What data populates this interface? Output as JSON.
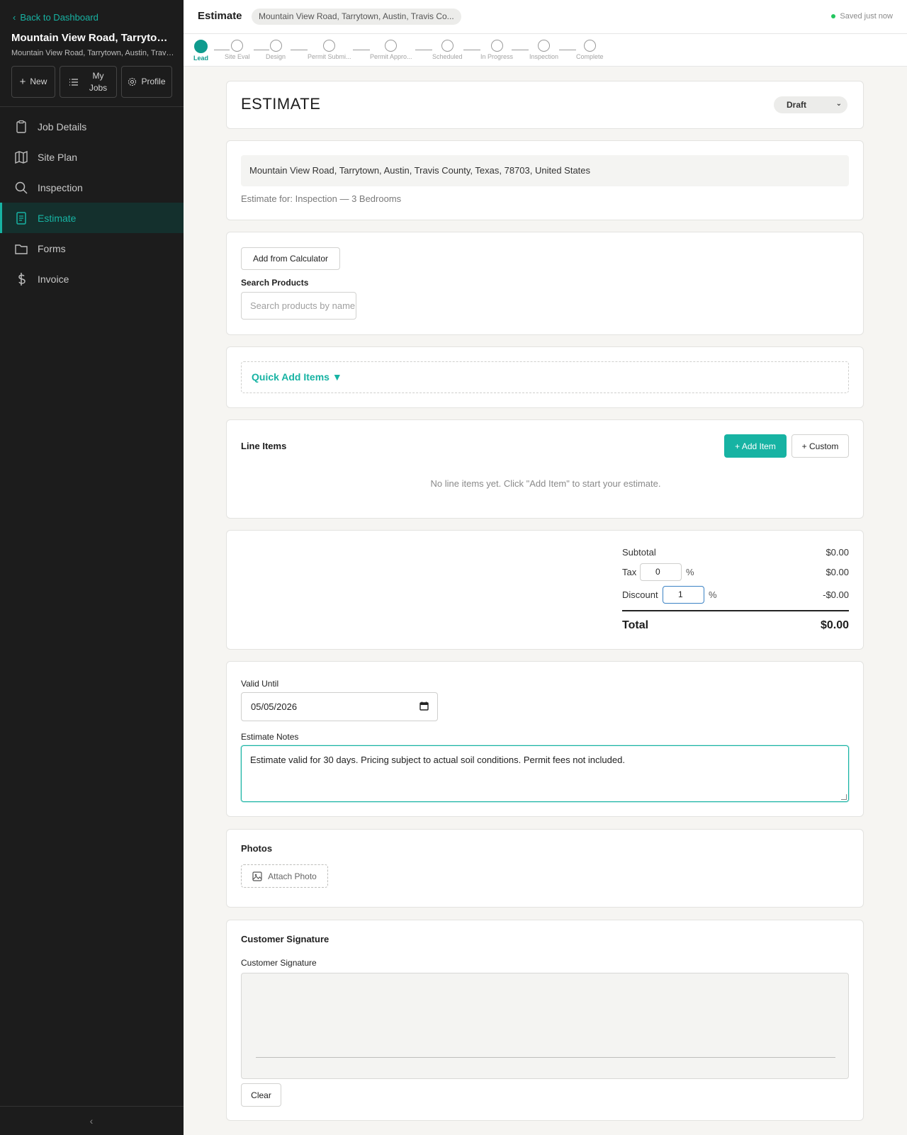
{
  "sidebar": {
    "back_label": "Back to Dashboard",
    "job_title": "Mountain View Road, Tarrytown, Austin, Travis County, Texas",
    "job_subtitle": "Mountain View Road, Tarrytown, Austin, Travis County, Texas",
    "buttons": {
      "new": "New",
      "my_jobs_line1": "My",
      "my_jobs_line2": "Jobs",
      "profile": "Profile"
    },
    "nav": [
      {
        "label": "Job Details",
        "icon": "clipboard-icon"
      },
      {
        "label": "Site Plan",
        "icon": "map-icon"
      },
      {
        "label": "Inspection",
        "icon": "search-icon"
      },
      {
        "label": "Estimate",
        "icon": "document-icon",
        "active": true
      },
      {
        "label": "Forms",
        "icon": "folder-icon"
      },
      {
        "label": "Invoice",
        "icon": "dollar-icon"
      }
    ],
    "collapse_icon": "chevron-left-icon"
  },
  "topbar": {
    "title": "Estimate",
    "address_pill": "Mountain View Road, Tarrytown, Austin, Travis Co...",
    "saved_status": "Saved just now"
  },
  "steps": [
    "Lead",
    "Site Eval",
    "Design",
    "Permit Submi...",
    "Permit Appro...",
    "Scheduled",
    "In Progress",
    "Inspection",
    "Complete"
  ],
  "estimate": {
    "heading": "ESTIMATE",
    "status": "Draft",
    "address": "Mountain View Road, Tarrytown, Austin, Travis County, Texas, 78703, United States",
    "estimate_for": "Estimate for: Inspection — 3 Bedrooms"
  },
  "products": {
    "add_from_calc": "Add from Calculator",
    "search_label": "Search Products",
    "search_placeholder": "Search products by name"
  },
  "quick_add": {
    "label": "Quick Add Items ▼"
  },
  "line_items": {
    "title": "Line Items",
    "add_item": "+ Add Item",
    "custom": "+ Custom",
    "empty_message": "No line items yet. Click \"Add Item\" to start your estimate."
  },
  "totals": {
    "subtotal_label": "Subtotal",
    "subtotal_value": "$0.00",
    "tax_label": "Tax",
    "tax_rate": "0",
    "tax_pct": "%",
    "tax_value": "$0.00",
    "discount_label": "Discount",
    "discount_rate": "1",
    "discount_pct": "%",
    "discount_value": "-$0.00",
    "total_label": "Total",
    "total_value": "$0.00"
  },
  "validity": {
    "valid_label": "Valid Until",
    "valid_date": "05/05/2026",
    "notes_label": "Estimate Notes",
    "notes_text": "Estimate valid for 30 days. Pricing subject to actual soil conditions. Permit fees not included."
  },
  "photos": {
    "title": "Photos",
    "attach_label": "Attach Photo"
  },
  "signature": {
    "title": "Customer Signature",
    "field_label": "Customer Signature",
    "clear_label": "Clear"
  },
  "colors": {
    "accent": "#17b3a3",
    "sidebar_bg": "#1c1c1c",
    "saved_dot": "#22c55e"
  }
}
